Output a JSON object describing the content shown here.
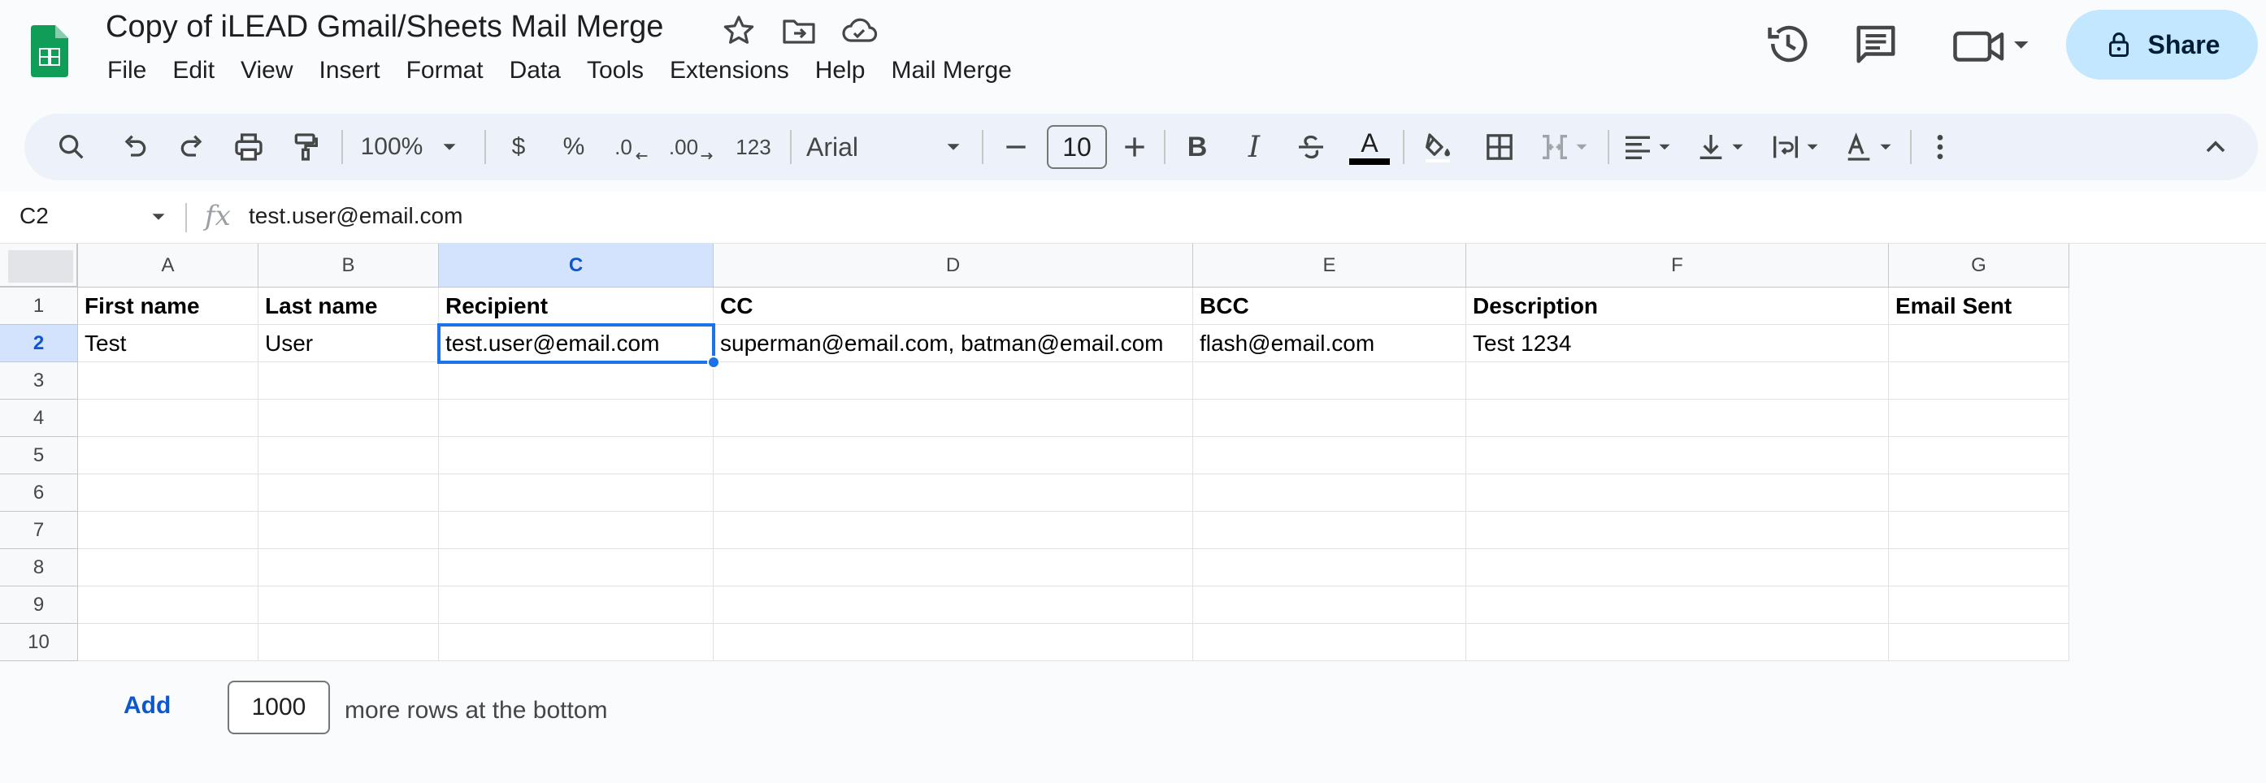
{
  "app": {
    "title": "Copy of iLEAD Gmail/Sheets Mail Merge",
    "brand_color": "#0f9d58",
    "accent_color": "#1a73e8"
  },
  "title_icons": [
    "star-icon",
    "move-to-folder-icon",
    "cloud-saved-icon"
  ],
  "menu": [
    "File",
    "Edit",
    "View",
    "Insert",
    "Format",
    "Data",
    "Tools",
    "Extensions",
    "Help",
    "Mail Merge"
  ],
  "header_actions": {
    "history_icon": "version-history-icon",
    "comments_icon": "comments-icon",
    "meet_icon": "meet-video-icon",
    "share_label": "Share"
  },
  "toolbar": {
    "zoom": "100%",
    "currency": "$",
    "percent": "%",
    "decrease_decimal": ".0",
    "increase_decimal": ".00",
    "number_format": "123",
    "font": "Arial",
    "font_size": "10",
    "bold": "B",
    "italic": "I",
    "text_color_letter": "A",
    "text_color": "#000000"
  },
  "formula_bar": {
    "name_box": "C2",
    "fx": "fx",
    "content": "test.user@email.com"
  },
  "sheet": {
    "columns": [
      "A",
      "B",
      "C",
      "D",
      "E",
      "F",
      "G"
    ],
    "selected_column": "C",
    "row_numbers": [
      "1",
      "2",
      "3",
      "4",
      "5",
      "6",
      "7",
      "8",
      "9",
      "10"
    ],
    "selected_row": "2",
    "header_row": [
      "First name",
      "Last name",
      "Recipient",
      "CC",
      "BCC",
      "Description",
      "Email Sent"
    ],
    "data_rows": [
      [
        "Test",
        "User",
        "test.user@email.com",
        "superman@email.com, batman@email.com",
        "flash@email.com",
        "Test 1234",
        ""
      ]
    ],
    "selected_cell": "C2"
  },
  "footer": {
    "add_label": "Add",
    "rows_value": "1000",
    "rows_label": "more rows at the bottom"
  }
}
